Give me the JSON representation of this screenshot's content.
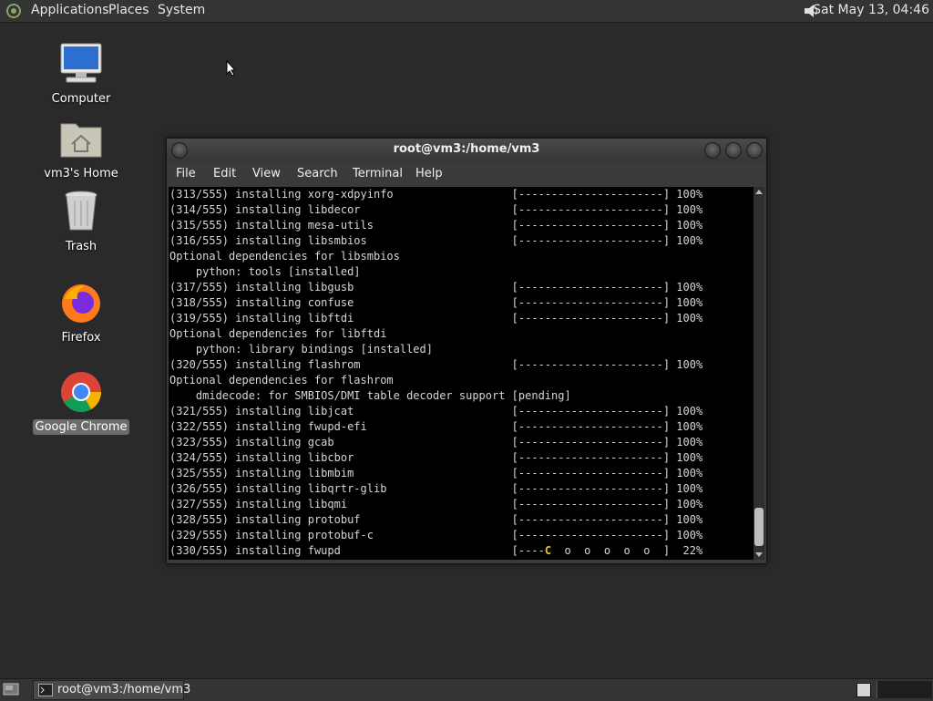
{
  "top_panel": {
    "menus": [
      "Applications",
      "Places",
      "System"
    ],
    "clock": "Sat May 13, 04:46"
  },
  "desktop": {
    "icons": [
      {
        "label": "Computer"
      },
      {
        "label": "vm3's Home"
      },
      {
        "label": "Trash"
      },
      {
        "label": "Firefox"
      },
      {
        "label": "Google Chrome",
        "selected": true
      }
    ]
  },
  "terminal": {
    "title": "root@vm3:/home/vm3",
    "menu": [
      "File",
      "Edit",
      "View",
      "Search",
      "Terminal",
      "Help"
    ],
    "lines": [
      "(313/555) installing xorg-xdpyinfo                  [----------------------] 100%",
      "(314/555) installing libdecor                       [----------------------] 100%",
      "(315/555) installing mesa-utils                     [----------------------] 100%",
      "(316/555) installing libsmbios                      [----------------------] 100%",
      "Optional dependencies for libsmbios",
      "    python: tools [installed]",
      "(317/555) installing libgusb                        [----------------------] 100%",
      "(318/555) installing confuse                        [----------------------] 100%",
      "(319/555) installing libftdi                        [----------------------] 100%",
      "Optional dependencies for libftdi",
      "    python: library bindings [installed]",
      "(320/555) installing flashrom                       [----------------------] 100%",
      "Optional dependencies for flashrom",
      "    dmidecode: for SMBIOS/DMI table decoder support [pending]",
      "(321/555) installing libjcat                        [----------------------] 100%",
      "(322/555) installing fwupd-efi                      [----------------------] 100%",
      "(323/555) installing gcab                           [----------------------] 100%",
      "(324/555) installing libcbor                        [----------------------] 100%",
      "(325/555) installing libmbim                        [----------------------] 100%",
      "(326/555) installing libqrtr-glib                   [----------------------] 100%",
      "(327/555) installing libqmi                         [----------------------] 100%",
      "(328/555) installing protobuf                       [----------------------] 100%",
      "(329/555) installing protobuf-c                     [----------------------] 100%"
    ],
    "current_line": {
      "prefix": "(330/555) installing fwupd                          [----",
      "pacman": "C",
      "suffix": "  o  o  o  o  o  ]  22%"
    }
  },
  "bottom_panel": {
    "task_label": "root@vm3:/home/vm3"
  },
  "colors": {
    "panel": "#343434",
    "desktop": "#2a2a2a",
    "terminal_bg": "#000000",
    "terminal_fg": "#d6d6d6",
    "pacman": "#f5c518"
  }
}
